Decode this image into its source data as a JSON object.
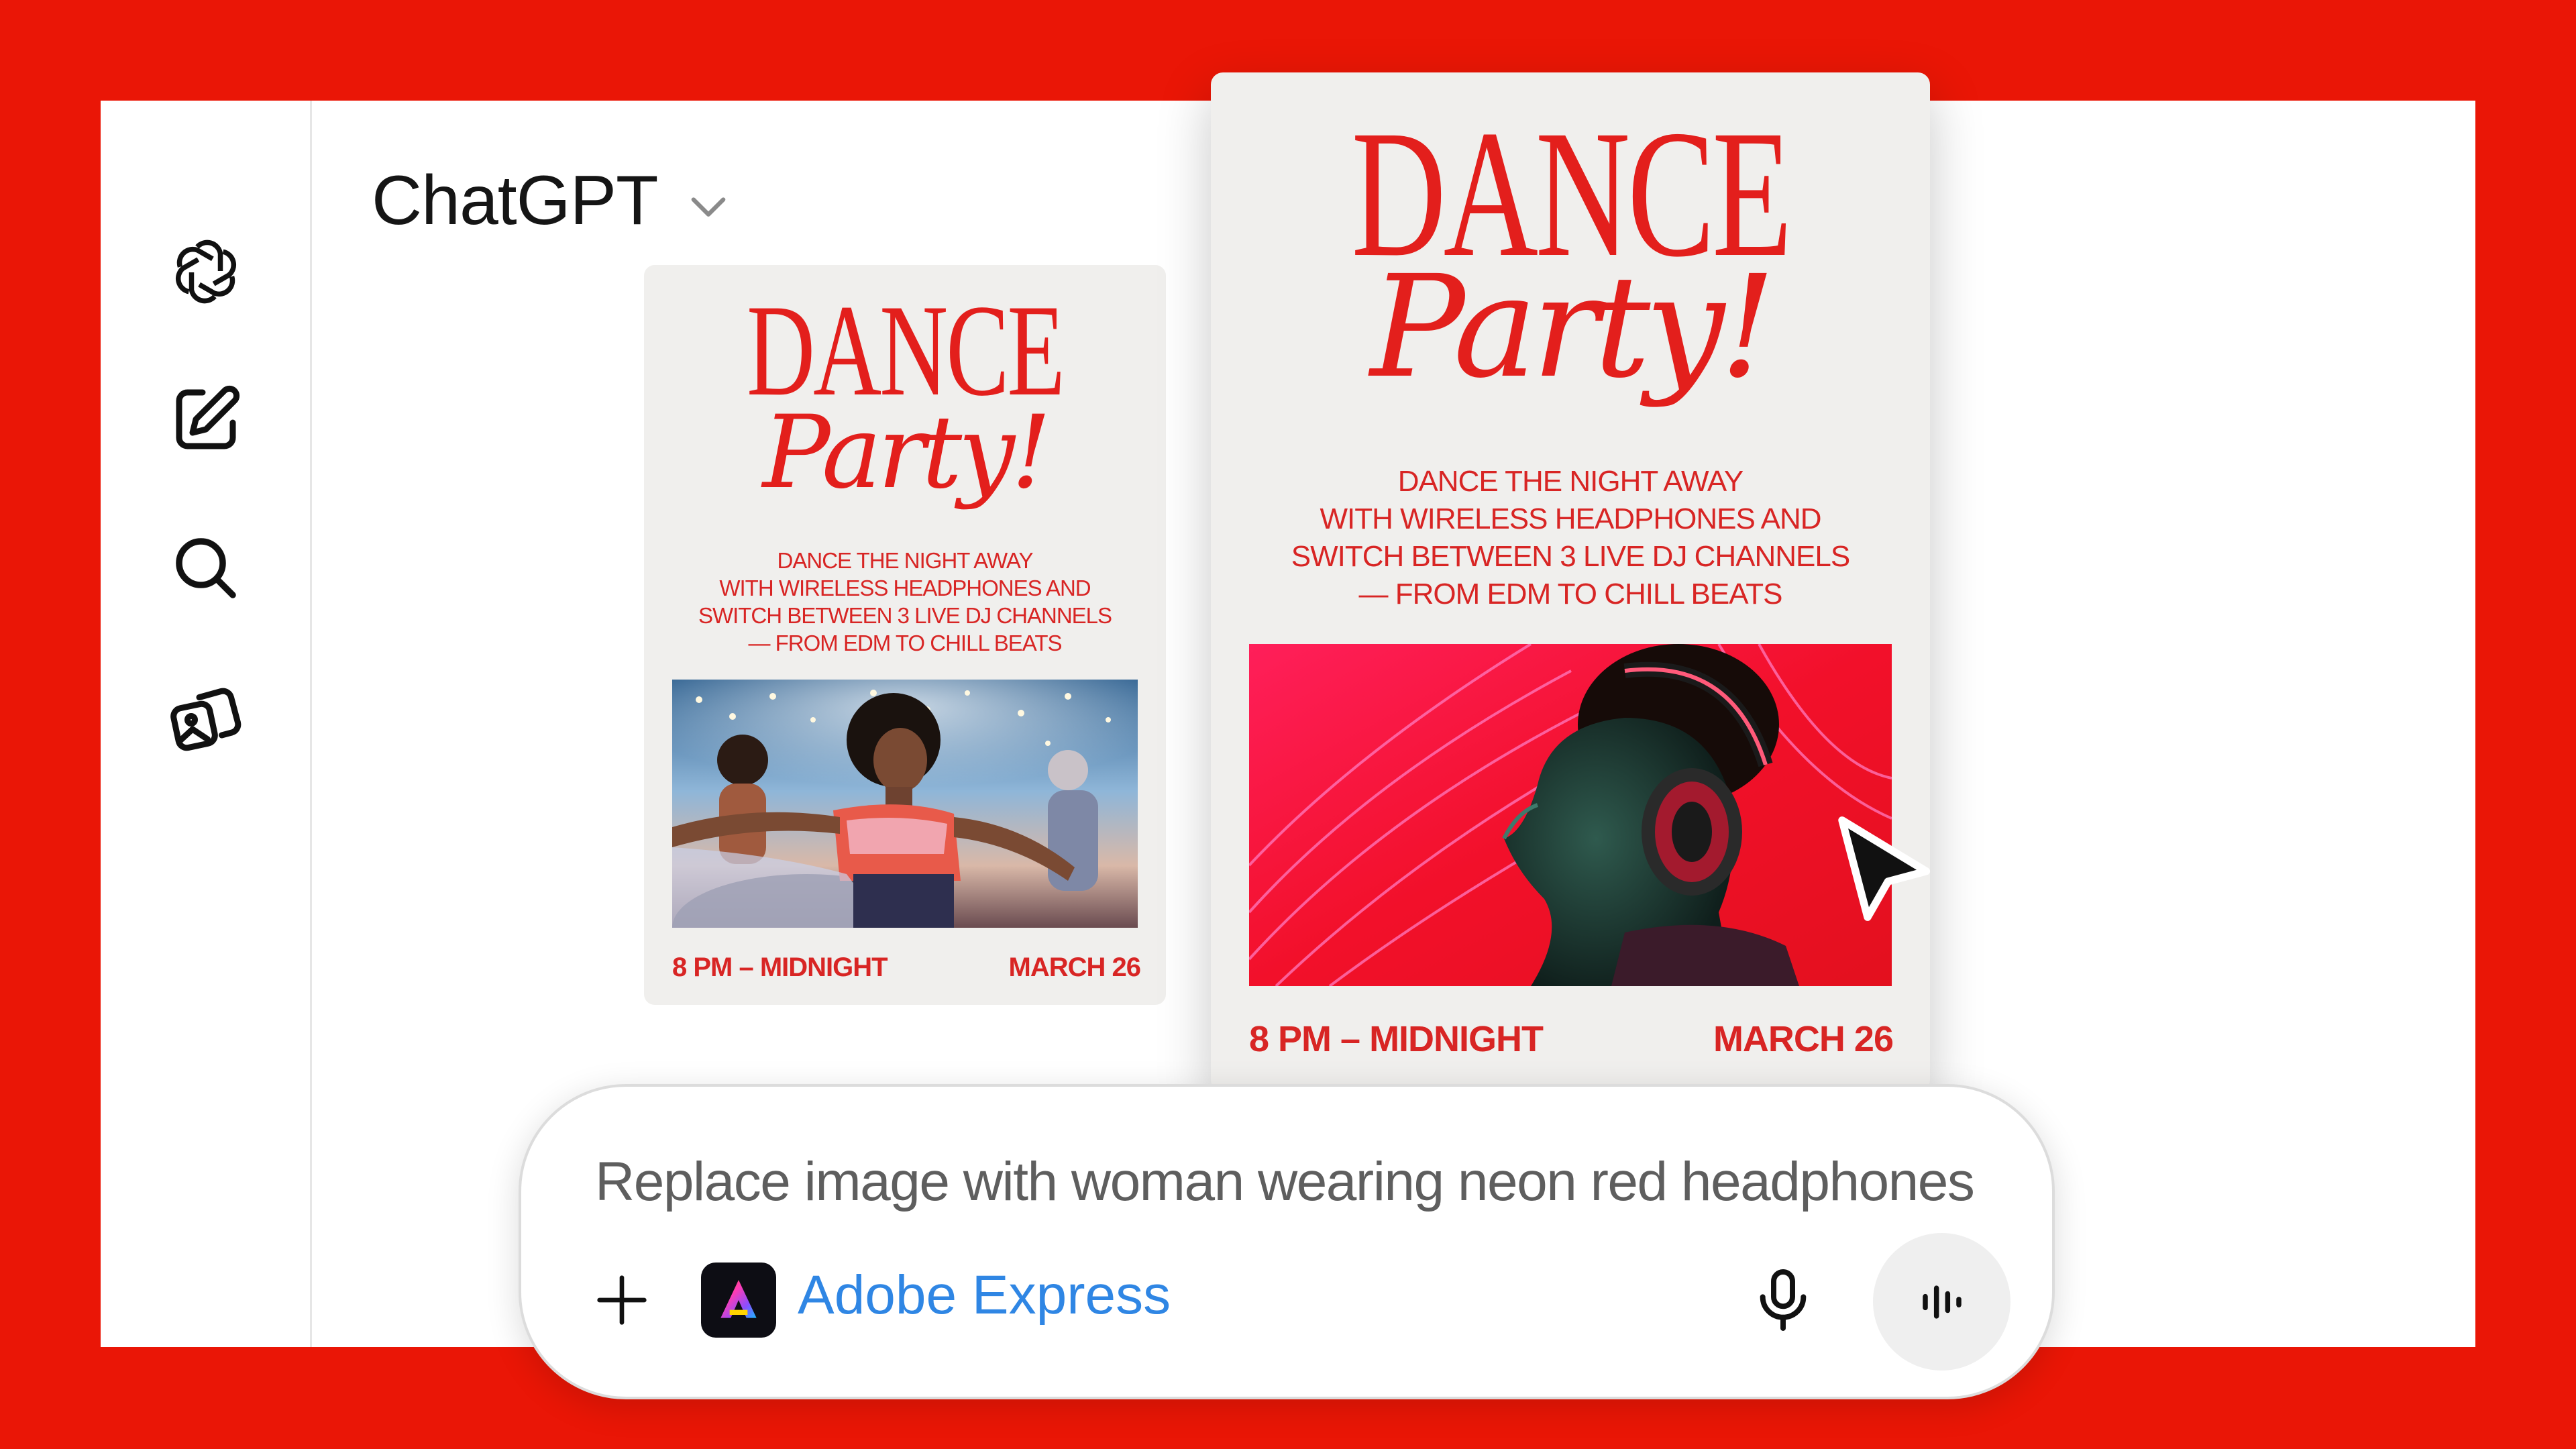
{
  "app": {
    "title": "ChatGPT",
    "title_dropdown_icon": "chevron-down-icon"
  },
  "sidebar": {
    "items": [
      {
        "icon": "openai-logo-icon"
      },
      {
        "icon": "new-chat-icon"
      },
      {
        "icon": "search-icon"
      },
      {
        "icon": "images-icon"
      }
    ]
  },
  "posters": [
    {
      "heading": "DANCE",
      "script": "Party!",
      "lines": [
        "DANCE THE NIGHT AWAY",
        "WITH WIRELESS HEADPHONES AND",
        "SWITCH BETWEEN 3 LIVE DJ CHANNELS",
        "— FROM EDM TO CHILL BEATS"
      ],
      "time": "8 PM – MIDNIGHT",
      "date": "MARCH 26"
    },
    {
      "heading": "DANCE",
      "script": "Party!",
      "lines": [
        "DANCE THE NIGHT AWAY",
        "WITH WIRELESS HEADPHONES AND",
        "SWITCH BETWEEN 3 LIVE DJ CHANNELS",
        "— FROM EDM TO CHILL BEATS"
      ],
      "time": "8 PM – MIDNIGHT",
      "date": "MARCH 26"
    }
  ],
  "composer": {
    "prompt": "Replace image with woman wearing neon red headphones",
    "app_name": "Adobe Express",
    "icons": [
      "plus-icon",
      "adobe-express-icon",
      "microphone-icon",
      "voice-mode-icon"
    ]
  },
  "colors": {
    "background": "#ea1606",
    "poster_red": "#e31f1c",
    "link_blue": "#2f86e4"
  }
}
